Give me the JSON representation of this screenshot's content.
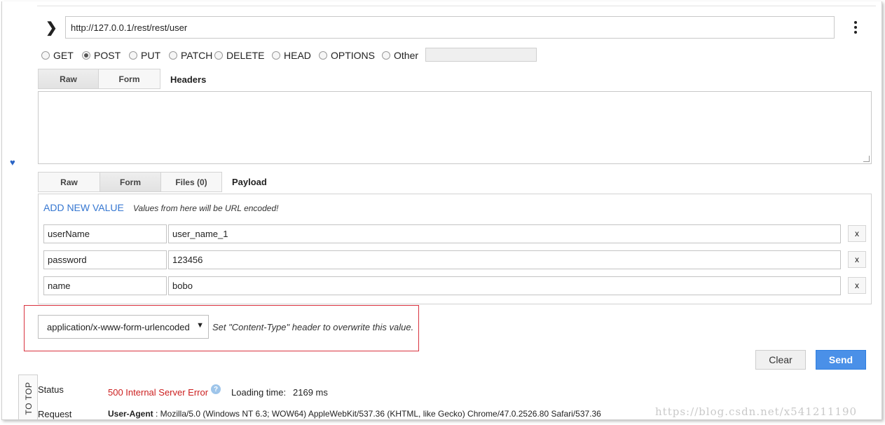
{
  "request": {
    "url": "http://127.0.0.1/rest/rest/user",
    "methods": [
      "GET",
      "POST",
      "PUT",
      "PATCH",
      "DELETE",
      "HEAD",
      "OPTIONS",
      "Other"
    ],
    "selected_method": "POST"
  },
  "headers": {
    "tabs": [
      "Raw",
      "Form"
    ],
    "active_tab": "Raw",
    "label": "Headers",
    "raw_value": ""
  },
  "payload": {
    "tabs": [
      "Raw",
      "Form",
      "Files (0)"
    ],
    "active_tab": "Form",
    "label": "Payload",
    "add_new_value": "ADD NEW VALUE",
    "encoding_note": "Values from here will be URL encoded!",
    "fields": [
      {
        "key": "userName",
        "value": "user_name_1",
        "remove": "x"
      },
      {
        "key": "password",
        "value": "123456",
        "remove": "x"
      },
      {
        "key": "name",
        "value": "bobo",
        "remove": "x"
      }
    ],
    "content_type": "application/x-www-form-urlencoded",
    "content_type_note": "Set \"Content-Type\" header to overwrite this value."
  },
  "actions": {
    "clear": "Clear",
    "send": "Send"
  },
  "to_top": "TO TOP",
  "response": {
    "status_label": "Status",
    "status_value": "500 Internal Server Error",
    "help": "?",
    "loading_label": "Loading time:",
    "loading_value": "2169 ms",
    "request_label": "Request",
    "ua_key": "User-Agent",
    "ua_value": ": Mozilla/5.0 (Windows NT 6.3; WOW64) AppleWebKit/537.36 (KHTML, like Gecko) Chrome/47.0.2526.80 Safari/537.36"
  },
  "watermark": "https://blog.csdn.net/x541211190",
  "colors": {
    "accent_blue": "#4a90e8",
    "link_blue": "#3677d1",
    "error_red": "#cc2020",
    "highlight_red": "#d9333f"
  }
}
